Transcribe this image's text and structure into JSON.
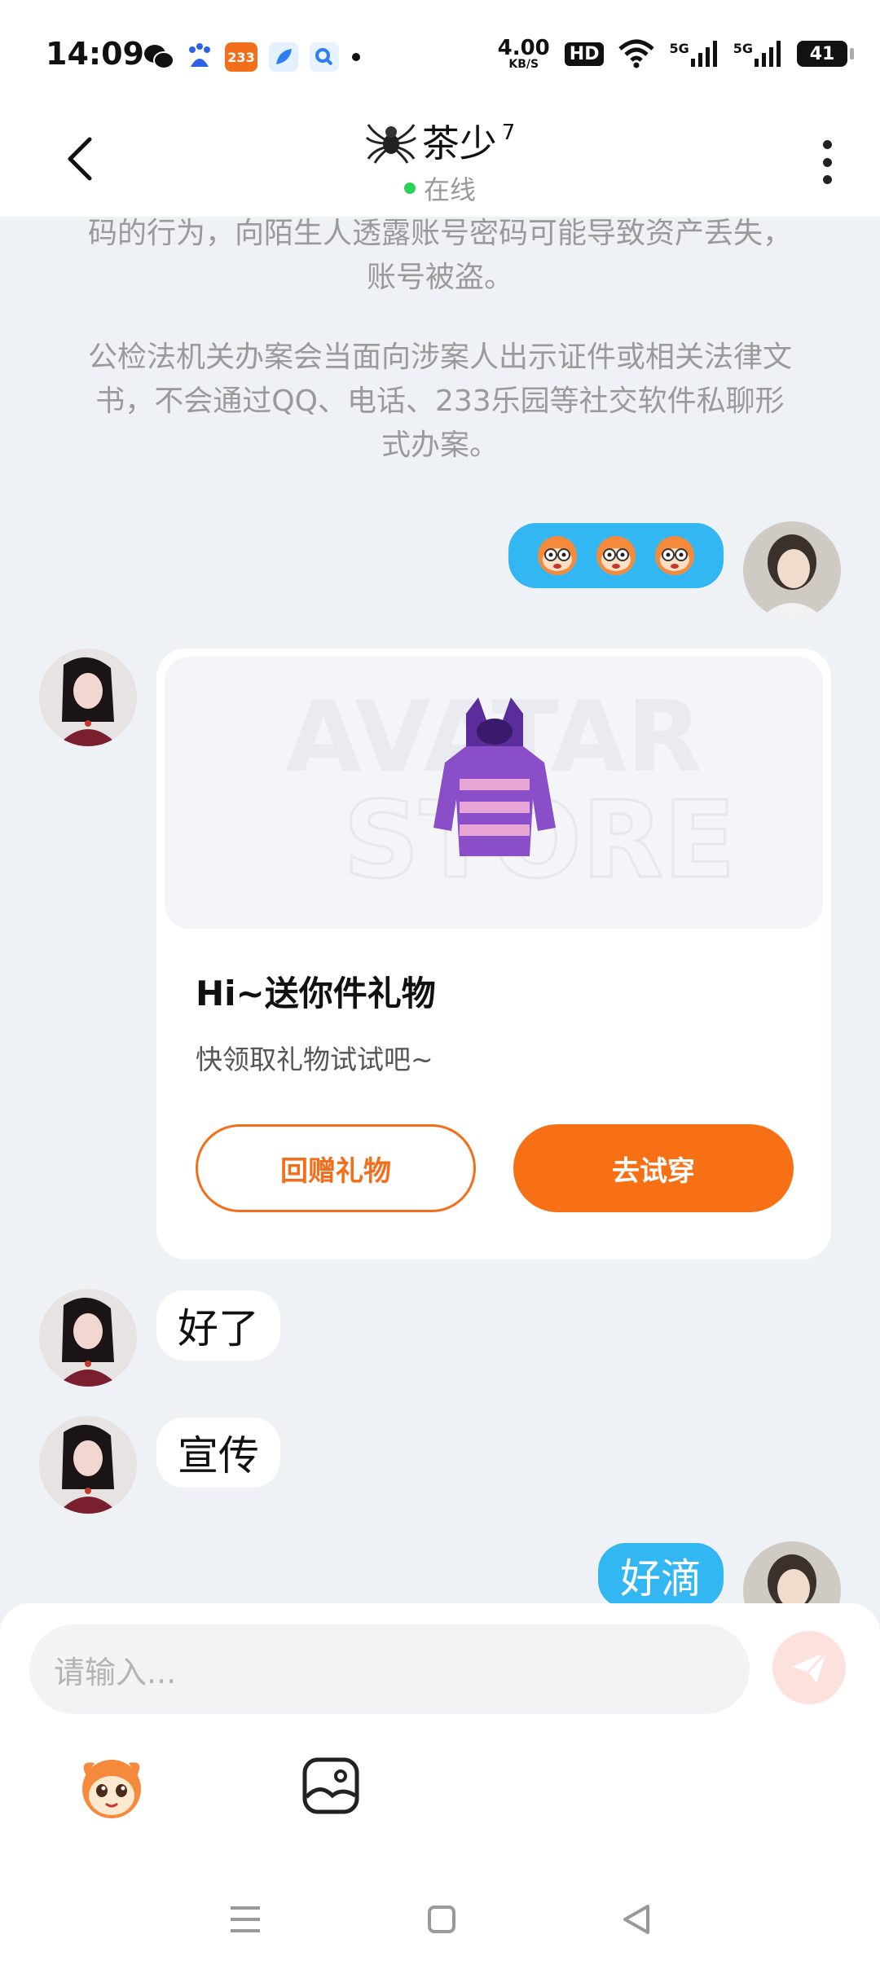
{
  "status_bar": {
    "time": "14:09",
    "net_speed_value": "4.00",
    "net_speed_unit": "KB/S",
    "hd": "HD",
    "signal1": "5G",
    "signal2": "5G",
    "battery": "41",
    "app_233": "233"
  },
  "header": {
    "title": "茶少",
    "level": "7",
    "status": "在线"
  },
  "notice": {
    "para1": "码的行为，向陌生人透露账号密码可能导致资产丢失，账号被盗。",
    "para2": "公检法机关办案会当面向涉案人出示证件或相关法律文书，不会通过QQ、电话、233乐园等社交软件私聊形式办案。"
  },
  "gift_card": {
    "title": "Hi~送你件礼物",
    "subtitle": "快领取礼物试试吧~",
    "return_gift_label": "回赠礼物",
    "try_on_label": "去试穿",
    "watermark_top": "AVATAR",
    "watermark_bottom": "STORE"
  },
  "messages": {
    "msg1": "好了",
    "msg2": "宣传",
    "msg3": "好滴"
  },
  "input": {
    "placeholder": "请输入..."
  },
  "colors": {
    "accent": "#f87015",
    "my_bubble": "#33b7f2",
    "online": "#2bd25a"
  }
}
